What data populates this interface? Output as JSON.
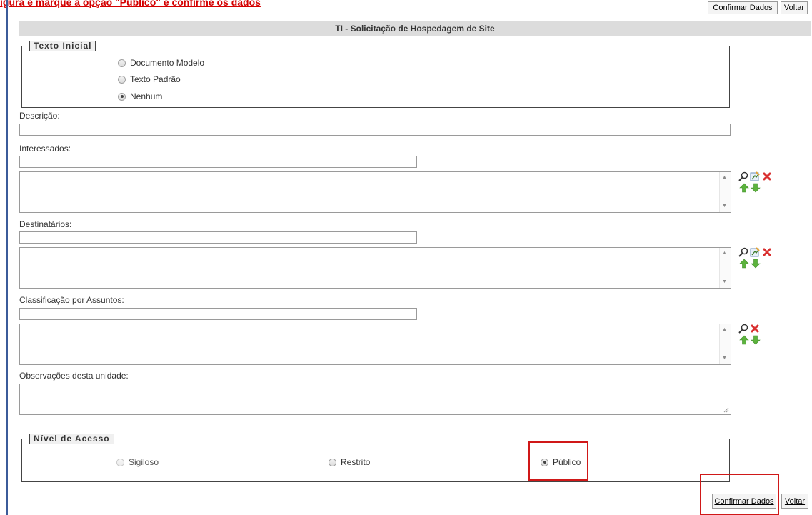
{
  "instruction": "igura e marque a opção \"Público\" e confirme os dados",
  "toolbar_top": {
    "confirm_label": "Confirmar Dados",
    "back_label": "Voltar"
  },
  "title": "TI - Solicitação de Hospedagem de Site",
  "texto_inicial": {
    "legend": "Texto Inicial",
    "options": [
      {
        "label": "Documento Modelo",
        "checked": false
      },
      {
        "label": "Texto Padrão",
        "checked": false
      },
      {
        "label": "Nenhum",
        "checked": true
      }
    ]
  },
  "fields": {
    "descricao": {
      "label": "Descrição:",
      "value": ""
    },
    "interessados": {
      "label": "Interessados:",
      "value": ""
    },
    "destinatarios": {
      "label": "Destinatários:",
      "value": ""
    },
    "classificacao": {
      "label": "Classificação por Assuntos:",
      "value": ""
    },
    "observacoes": {
      "label": "Observações desta unidade:",
      "value": ""
    }
  },
  "nivel_acesso": {
    "legend": "Nível de Acesso",
    "options": [
      {
        "label": "Sigiloso",
        "checked": false,
        "disabled": true
      },
      {
        "label": "Restrito",
        "checked": false,
        "disabled": false
      },
      {
        "label": "Público",
        "checked": true,
        "disabled": false
      }
    ]
  },
  "toolbar_bottom": {
    "confirm_label": "Confirmar Dados",
    "back_label": "Voltar"
  },
  "icons": {
    "search": "search-icon",
    "edit": "edit-icon",
    "remove": "remove-icon",
    "move_up": "arrow-up-icon",
    "move_down": "arrow-down-icon"
  },
  "colors": {
    "highlight": "#d01818",
    "instruction": "#d40000",
    "header_bg": "#dcdcdc"
  }
}
